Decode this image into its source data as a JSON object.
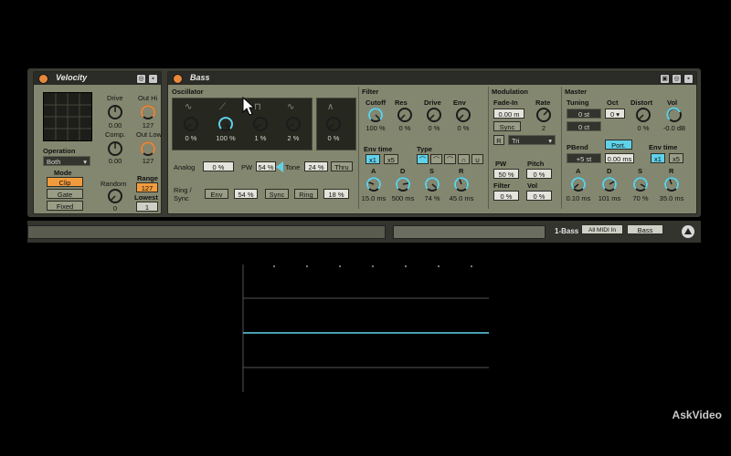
{
  "velocity": {
    "title": "Velocity",
    "drive_label": "Drive",
    "outhi_label": "Out Hi",
    "outhi_value": "127",
    "comp_label": "Comp.",
    "comp_value": "0.00",
    "drive_value": "0.00",
    "outlow_label": "Out Low",
    "outlow_value": "127",
    "random_label": "Random",
    "random_value": "0",
    "operation_label": "Operation",
    "operation_value": "Both",
    "mode_label": "Mode",
    "mode_options": [
      "Clip",
      "Gate",
      "Fixed"
    ],
    "range_label": "Range",
    "range_value": "127",
    "lowest_label": "Lowest",
    "lowest_value": "1"
  },
  "bass": {
    "title": "Bass",
    "oscillator": {
      "label": "Oscillator",
      "knob_values": [
        "0 %",
        "100 %",
        "1 %",
        "2 %",
        "0 %"
      ],
      "analog_label": "Analog",
      "analog_value": "0 %",
      "pw_label": "PW",
      "pw_value": "54 %",
      "tone_label": "Tone",
      "tone_value": "24 %",
      "thru_label": "Thru",
      "ring_label": "Ring /",
      "sync_label": "Sync",
      "env_label": "Env",
      "env_value": "54 %",
      "sync_btn": "Sync",
      "ring_btn": "Ring",
      "ring_value": "18 %"
    },
    "filter": {
      "label": "Filter",
      "knob_labels": [
        "Cutoff",
        "Res",
        "Drive",
        "Env"
      ],
      "knob_values": [
        "100 %",
        "0 %",
        "0 %",
        "0 %"
      ],
      "envtime_label": "Env time",
      "envtime_x1": "x1",
      "envtime_x5": "x5",
      "type_label": "Type",
      "adsr_labels": [
        "A",
        "D",
        "S",
        "R"
      ],
      "adsr_values": [
        "15.0 ms",
        "500 ms",
        "74 %",
        "45.0 ms"
      ]
    },
    "modulation": {
      "label": "Modulation",
      "fadein_label": "Fade-In",
      "fadein_value": "0.00 m",
      "rate_label": "Rate",
      "rate_value": "2",
      "sync_btn": "Sync",
      "r_btn": "R",
      "wave_value": "Tri",
      "pw_label": "PW",
      "pw_value": "50 %",
      "pitch_label": "Pitch",
      "pitch_value": "0 %",
      "filter_label": "Filter",
      "filter_value": "0 %",
      "vol_label": "Vol",
      "vol_value": "0 %"
    },
    "master": {
      "label": "Master",
      "tuning_label": "Tuning",
      "tuning_st": "0 st",
      "tuning_ct": "0 ct",
      "oct_label": "Oct",
      "oct_value": "0",
      "distort_label": "Distort",
      "distort_value": "0 %",
      "vol_label": "Vol",
      "vol_value": "-0.0 dB",
      "pbend_label": "PBend",
      "pbend_value": "+5 st",
      "port_btn": "Port.",
      "port_value": "0.00 ms",
      "envtime_label": "Env time",
      "envtime_x1": "x1",
      "envtime_x5": "x5",
      "adsr_labels": [
        "A",
        "D",
        "S",
        "R"
      ],
      "adsr_values": [
        "0.10 ms",
        "101 ms",
        "70 %",
        "35.0 ms"
      ]
    }
  },
  "chain": {
    "name": "1-Bass",
    "midi_in": "All MIDI In",
    "target": "Bass"
  },
  "watermark": "AskVideo",
  "colors": {
    "device_body": "#84876f",
    "accent_orange": "#f29b3c",
    "accent_cyan": "#5fd2ea"
  }
}
